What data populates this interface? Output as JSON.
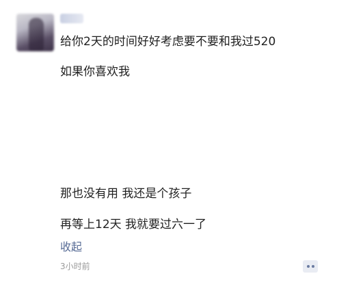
{
  "post": {
    "lines": [
      "给你2天的时间好好考虑要不要和我过520",
      "如果你喜欢我",
      "那也没有用 我还是个孩子",
      "再等上12天 我就要过六一了"
    ],
    "collapse_label": "收起",
    "timestamp": "3小时前"
  },
  "icons": {
    "comment": "comment-more-icon"
  },
  "colors": {
    "text": "#1f1f1f",
    "link": "#576b95",
    "timestamp": "#9a9a9a",
    "comment_button_bg": "#e9ecf3"
  }
}
